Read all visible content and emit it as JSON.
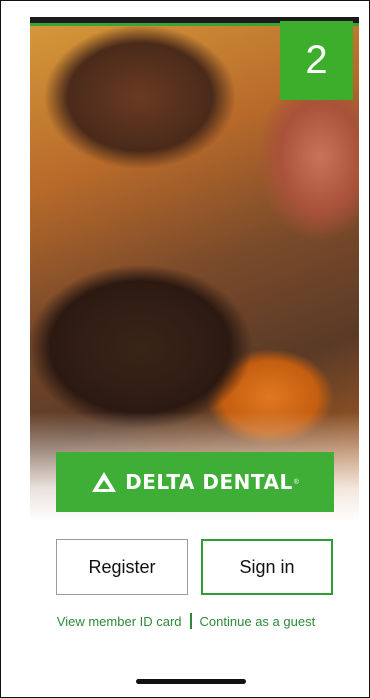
{
  "badge": {
    "number": "2"
  },
  "brand": {
    "name": "DELTA DENTAL",
    "registered": "®"
  },
  "actions": {
    "register_label": "Register",
    "signin_label": "Sign in"
  },
  "links": {
    "member_id": "View member ID card",
    "guest": "Continue as a guest"
  },
  "colors": {
    "brand_green": "#3fae36",
    "link_green": "#2c8a37"
  },
  "hero": {
    "image": "family-photo"
  }
}
